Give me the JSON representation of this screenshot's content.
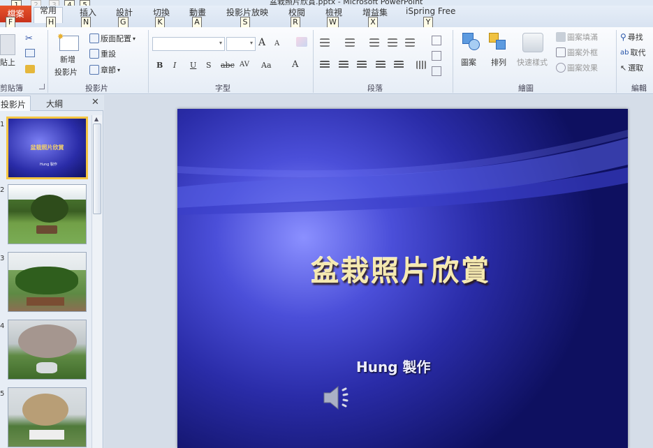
{
  "window": {
    "title": "盆栽照片欣賞.pptx - Microsoft PowerPoint"
  },
  "qat": {
    "keytips": [
      "1",
      "2",
      "3",
      "4",
      "5"
    ]
  },
  "tabs": [
    {
      "label": "檔案",
      "key": "F"
    },
    {
      "label": "常用",
      "key": "H"
    },
    {
      "label": "插入",
      "key": "N"
    },
    {
      "label": "設計",
      "key": "G"
    },
    {
      "label": "切換",
      "key": "K"
    },
    {
      "label": "動畫",
      "key": "A"
    },
    {
      "label": "投影片放映",
      "key": "S"
    },
    {
      "label": "校閱",
      "key": "R"
    },
    {
      "label": "檢視",
      "key": "W"
    },
    {
      "label": "增益集",
      "key": "X"
    },
    {
      "label": "iSpring Free",
      "key": "Y"
    }
  ],
  "ribbon": {
    "clipboard": {
      "label": "剪貼簿",
      "paste": "貼上"
    },
    "slides": {
      "label": "投影片",
      "new_slide_1": "新增",
      "new_slide_2": "投影片",
      "layout": "版面配置",
      "reset": "重設",
      "section": "章節"
    },
    "font": {
      "label": "字型",
      "bold": "B",
      "italic": "I",
      "underline": "U",
      "shadow": "S",
      "strike": "abc",
      "spacing": "AV",
      "case": "Aa",
      "color": "A",
      "grow": "A",
      "shrink": "A"
    },
    "paragraph": {
      "label": "段落"
    },
    "drawing": {
      "label": "繪圖",
      "shapes": "圖案",
      "arrange": "排列",
      "quick_styles": "快速樣式",
      "fill": "圖案填滿",
      "outline": "圖案外框",
      "effects": "圖案效果"
    },
    "editing": {
      "label": "編輯",
      "find": "尋找",
      "replace": "取代",
      "select": "選取"
    }
  },
  "pane": {
    "tab_slides": "投影片",
    "tab_outline": "大綱",
    "close": "✕",
    "thumbs": [
      {
        "num": "1",
        "title": "盆栽照片欣賞",
        "sub": "Hung 製作"
      },
      {
        "num": "2"
      },
      {
        "num": "3"
      },
      {
        "num": "4"
      },
      {
        "num": "5"
      }
    ]
  },
  "slide": {
    "title": "盆栽照片欣賞",
    "subtitle": "Hung 製作"
  },
  "colors": {
    "file_tab": "#d9401f",
    "slide_bg_center": "#8b90ff",
    "slide_bg_edge": "#0e1060",
    "title_text": "#f5e9b0",
    "selection": "#f4c542"
  }
}
